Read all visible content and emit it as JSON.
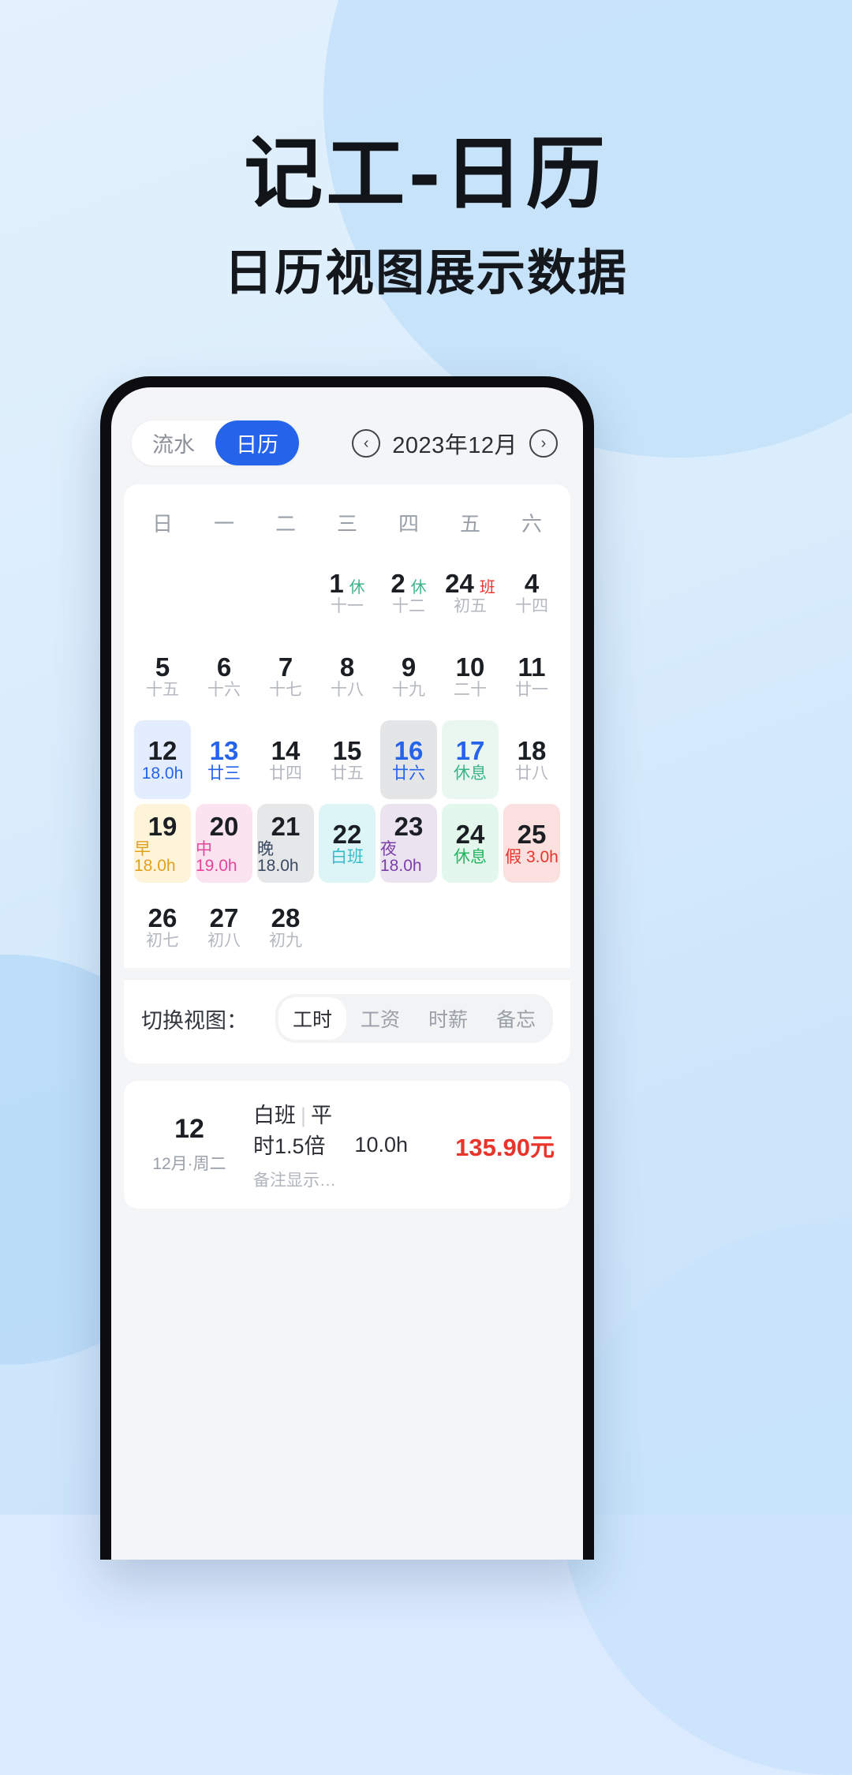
{
  "hero": {
    "title": "记工-日历",
    "subtitle": "日历视图展示数据"
  },
  "colors": {
    "accent": "#2563eb",
    "money": "#e8342a",
    "rest_green": "#3cb489",
    "work_red": "#e8342a",
    "page_bg": "#dbeafe"
  },
  "topbar": {
    "segments": [
      {
        "label": "流水",
        "active": false
      },
      {
        "label": "日历",
        "active": true
      }
    ],
    "prev_icon": "chevron-left-circle-icon",
    "next_icon": "chevron-right-circle-icon",
    "date_label": "2023年12月"
  },
  "calendar": {
    "weekdays": [
      "日",
      "一",
      "二",
      "三",
      "四",
      "五",
      "六"
    ],
    "rows": [
      [
        {
          "empty": true
        },
        {
          "empty": true
        },
        {
          "empty": true
        },
        {
          "num": "1",
          "tag": "休",
          "tag_color": "#3cb489",
          "sub": "十一",
          "bg": "transparent"
        },
        {
          "num": "2",
          "tag": "休",
          "tag_color": "#3cb489",
          "sub": "十二",
          "bg": "transparent"
        },
        {
          "num": "24",
          "tag": "班",
          "tag_color": "#e8342a",
          "sub": "初五",
          "bg": "transparent"
        },
        {
          "num": "4",
          "tag": "",
          "tag_color": "",
          "sub": "十四",
          "bg": "transparent"
        }
      ],
      [
        {
          "num": "5",
          "sub": "十五",
          "bg": "transparent"
        },
        {
          "num": "6",
          "sub": "十六",
          "bg": "transparent"
        },
        {
          "num": "7",
          "sub": "十七",
          "bg": "transparent"
        },
        {
          "num": "8",
          "sub": "十八",
          "bg": "transparent"
        },
        {
          "num": "9",
          "sub": "十九",
          "bg": "transparent"
        },
        {
          "num": "10",
          "sub": "二十",
          "bg": "transparent"
        },
        {
          "num": "11",
          "sub": "廿一",
          "bg": "transparent"
        }
      ],
      [
        {
          "num": "12",
          "sub": "18.0h",
          "bg": "#e3edfd",
          "num_color": "#1b1f24",
          "sub_color": "#2563eb"
        },
        {
          "num": "13",
          "sub": "廿三",
          "bg": "transparent",
          "num_color": "#2563eb",
          "sub_color": "#2563eb"
        },
        {
          "num": "14",
          "sub": "廿四",
          "bg": "transparent"
        },
        {
          "num": "15",
          "sub": "廿五",
          "bg": "transparent"
        },
        {
          "num": "16",
          "sub": "廿六",
          "bg": "#e4e5e7",
          "num_color": "#2563eb",
          "sub_color": "#2563eb"
        },
        {
          "num": "17",
          "sub": "休息",
          "bg": "#eaf7f1",
          "num_color": "#2563eb",
          "sub_color": "#3cb489"
        },
        {
          "num": "18",
          "sub": "廿八",
          "bg": "transparent"
        }
      ],
      [
        {
          "num": "19",
          "sub": "早 18.0h",
          "bg": "#fdf4d9",
          "sub_color": "#e0a21a"
        },
        {
          "num": "20",
          "sub": "中 19.0h",
          "bg": "#fbe4f0",
          "sub_color": "#e4459a"
        },
        {
          "num": "21",
          "sub": "晚 18.0h",
          "bg": "#e6e7e9",
          "sub_color": "#3b4a63"
        },
        {
          "num": "22",
          "sub": "白班",
          "bg": "#ddf5f6",
          "sub_color": "#35bcc9"
        },
        {
          "num": "23",
          "sub": "夜 18.0h",
          "bg": "#ece3f1",
          "sub_color": "#7a3fa8"
        },
        {
          "num": "24",
          "sub": "休息",
          "bg": "#e3f7ec",
          "sub_color": "#28b561"
        },
        {
          "num": "25",
          "sub": "假 3.0h",
          "bg": "#fbe0e0",
          "sub_color": "#e8342a"
        }
      ],
      [
        {
          "num": "26",
          "sub": "初七",
          "bg": "transparent"
        },
        {
          "num": "27",
          "sub": "初八",
          "bg": "transparent"
        },
        {
          "num": "28",
          "sub": "初九",
          "bg": "transparent"
        },
        {
          "empty": true
        },
        {
          "empty": true
        },
        {
          "empty": true
        },
        {
          "empty": true
        }
      ]
    ]
  },
  "view_switch": {
    "label": "切换视图：",
    "options": [
      {
        "label": "工时",
        "active": true
      },
      {
        "label": "工资",
        "active": false
      },
      {
        "label": "时薪",
        "active": false
      },
      {
        "label": "备忘",
        "active": false
      }
    ]
  },
  "record": {
    "day": "12",
    "day_sub": "12月·周二",
    "shift": "白班",
    "separator": "|",
    "rate": "平时1.5倍",
    "note": "备注显示在这里，最多一行...",
    "hours": "10.0h",
    "amount": "135.90元"
  }
}
